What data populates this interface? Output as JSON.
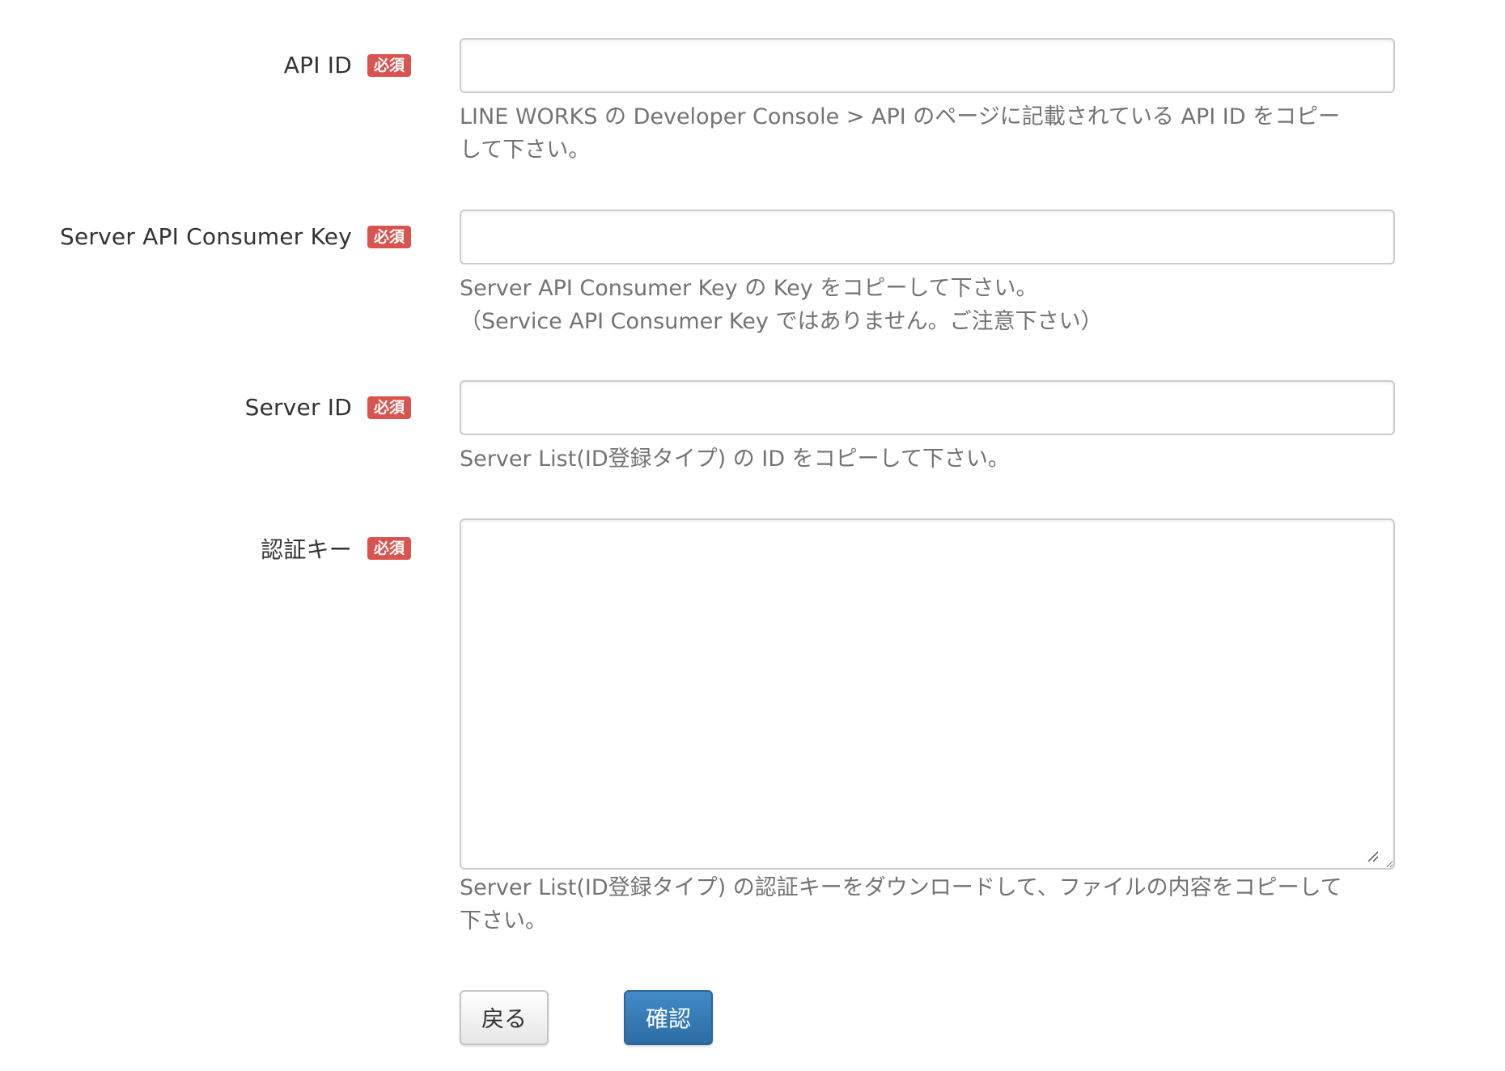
{
  "required_badge": "必須",
  "fields": [
    {
      "label": "API ID",
      "value": "",
      "help": [
        "LINE WORKS の Developer Console > API のページに記載されている API ID をコピー",
        "して下さい。"
      ]
    },
    {
      "label": "Server API Consumer Key",
      "value": "",
      "help": [
        "Server API Consumer Key の Key をコピーして下さい。",
        "（Service API Consumer Key ではありません。ご注意下さい）"
      ]
    },
    {
      "label": "Server ID",
      "value": "",
      "help": [
        "Server List(ID登録タイプ) の ID をコピーして下さい。"
      ]
    },
    {
      "label": "認証キー",
      "value": "",
      "help": [
        "Server List(ID登録タイプ) の認証キーをダウンロードして、ファイルの内容をコピーして",
        "下さい。"
      ]
    }
  ],
  "buttons": {
    "back_label": "戻る",
    "confirm_label": "確認"
  },
  "colors": {
    "required_badge": "#d9534f",
    "primary_button": "#337ab7",
    "help_text": "#737373"
  }
}
